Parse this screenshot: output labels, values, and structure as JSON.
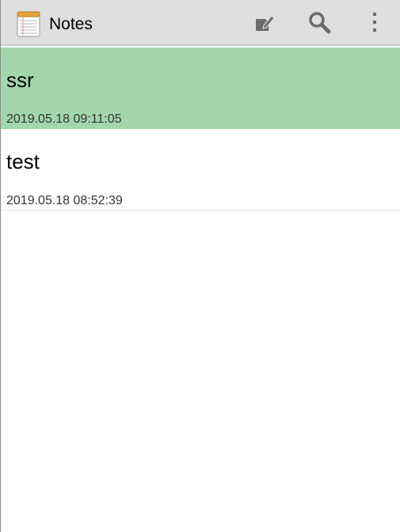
{
  "app": {
    "title": "Notes"
  },
  "toolbar": {
    "icons": [
      "notepad-icon",
      "new-note-icon",
      "search-icon",
      "overflow-menu-icon"
    ]
  },
  "notes": [
    {
      "title": "ssr",
      "date": "2019.05.18 09:11:05",
      "selected": true
    },
    {
      "title": "test",
      "date": "2019.05.18 08:52:39",
      "selected": false
    }
  ],
  "colors": {
    "action_bar": "#dedede",
    "selected_row": "#a3d6ad",
    "icon_gray": "#6b6b6b"
  }
}
